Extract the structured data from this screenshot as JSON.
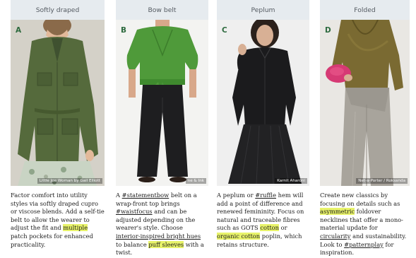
{
  "cards": [
    {
      "header": "Softly draped",
      "letter": "A",
      "credit": "Little Joe Woman by Gail Elliott",
      "caption": [
        {
          "t": "Factor comfort into utility styles via softly draped cupro or viscose blends. Add a self-tie belt to allow the wearer to adjust the fit and "
        },
        {
          "t": "multiple",
          "hl": true
        },
        {
          "t": " patch pockets for enhanced practicality."
        }
      ]
    },
    {
      "header": "Bow belt",
      "letter": "B",
      "credit": "ne & Ink",
      "caption": [
        {
          "t": "A "
        },
        {
          "t": "#statementbow",
          "u": true
        },
        {
          "t": " belt on a wrap-front top brings "
        },
        {
          "t": "#waistfocus",
          "u": true
        },
        {
          "t": "  and can be adjusted depending on the wearer's style. Choose "
        },
        {
          "t": "interior-inspired bright hues",
          "u": true
        },
        {
          "t": " to balance "
        },
        {
          "t": "puff sleeves",
          "hl": true
        },
        {
          "t": " with a twist."
        }
      ]
    },
    {
      "header": "Peplum",
      "letter": "C",
      "credit": "Karnit Aharoni",
      "caption": [
        {
          "t": "A peplum or "
        },
        {
          "t": "#ruffle",
          "u": true
        },
        {
          "t": " hem will add a point of difference and renewed femininity. Focus on natural and traceable fibres such as GOTS "
        },
        {
          "t": "cotton",
          "hl": true
        },
        {
          "t": " or "
        },
        {
          "t": "organic cotton",
          "hl": true
        },
        {
          "t": " poplin, which retains structure."
        }
      ]
    },
    {
      "header": "Folded",
      "letter": "D",
      "credit": "Net-a-Porter / Roksanda",
      "caption": [
        {
          "t": "Create new classics by focusing on details such as "
        },
        {
          "t": "asymmetric",
          "hl": true
        },
        {
          "t": " foldover necklines that offer a mono-material update for "
        },
        {
          "t": "circularity",
          "u": true
        },
        {
          "t": " and sustainability. Look to "
        },
        {
          "t": "#patternplay",
          "u": true
        },
        {
          "t": " for inspiration."
        }
      ]
    }
  ]
}
